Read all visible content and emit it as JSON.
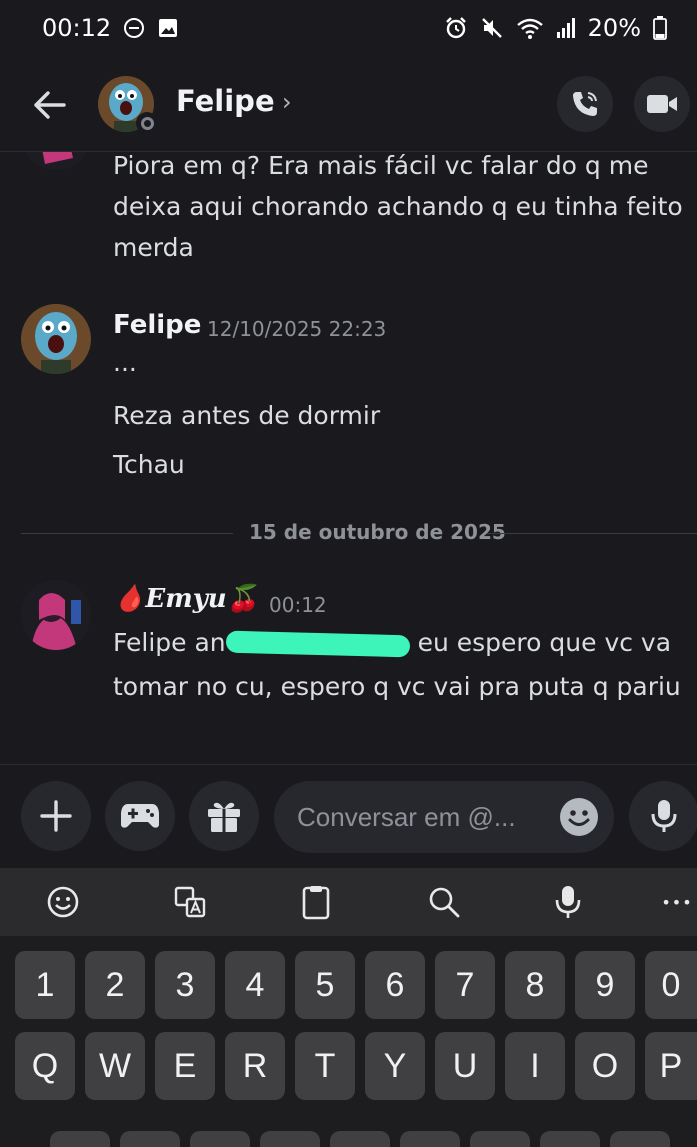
{
  "status_bar": {
    "time": "00:12",
    "battery": "20%",
    "left_icons": [
      "do-not-disturb-icon",
      "image-icon"
    ],
    "right_icons": [
      "alarm-icon",
      "mute-icon",
      "wifi-icon",
      "signal-icon",
      "battery-icon"
    ]
  },
  "header": {
    "contact_name": "Felipe",
    "chevron": "›",
    "call_icon": "phone-icon",
    "video_icon": "video-icon"
  },
  "messages": {
    "m1_text_lines": [
      "Piora em q? Era mais fácil vc falar do q me",
      "deixa aqui chorando achando q eu tinha feito",
      "merda"
    ],
    "m2_author": "Felipe",
    "m2_timestamp": "12/10/2025 22:23",
    "m2_lines": [
      "...",
      "Reza antes de dormir",
      "Tchau"
    ],
    "date_divider": "15 de outubro de 2025",
    "m3_author_prefix": "🩸",
    "m3_author": "Emyu",
    "m3_author_suffix": "🍒",
    "m3_timestamp": "00:12",
    "m3_line1_start": "Felipe an",
    "m3_line1_end": " eu espero que vc va",
    "m3_line2": "tomar no cu, espero q vc vai pra puta q pariu"
  },
  "composer": {
    "placeholder": "Conversar em @...",
    "buttons": [
      "plus-icon",
      "gamepad-icon",
      "gift-icon",
      "emoji-icon",
      "microphone-icon"
    ]
  },
  "keyboard": {
    "toolbar": [
      "emoji-icon",
      "translate-icon",
      "clipboard-icon",
      "search-icon",
      "microphone-icon",
      "more-icon"
    ],
    "more_label": "•••",
    "row_numbers": [
      "1",
      "2",
      "3",
      "4",
      "5",
      "6",
      "7",
      "8",
      "9",
      "0"
    ],
    "row_letters": [
      "Q",
      "W",
      "E",
      "R",
      "T",
      "Y",
      "U",
      "I",
      "O",
      "P"
    ]
  },
  "colors": {
    "background": "#1a1a1e",
    "bubble": "#27282d",
    "highlight_scribble": "#3df5b8",
    "key": "#404043"
  }
}
